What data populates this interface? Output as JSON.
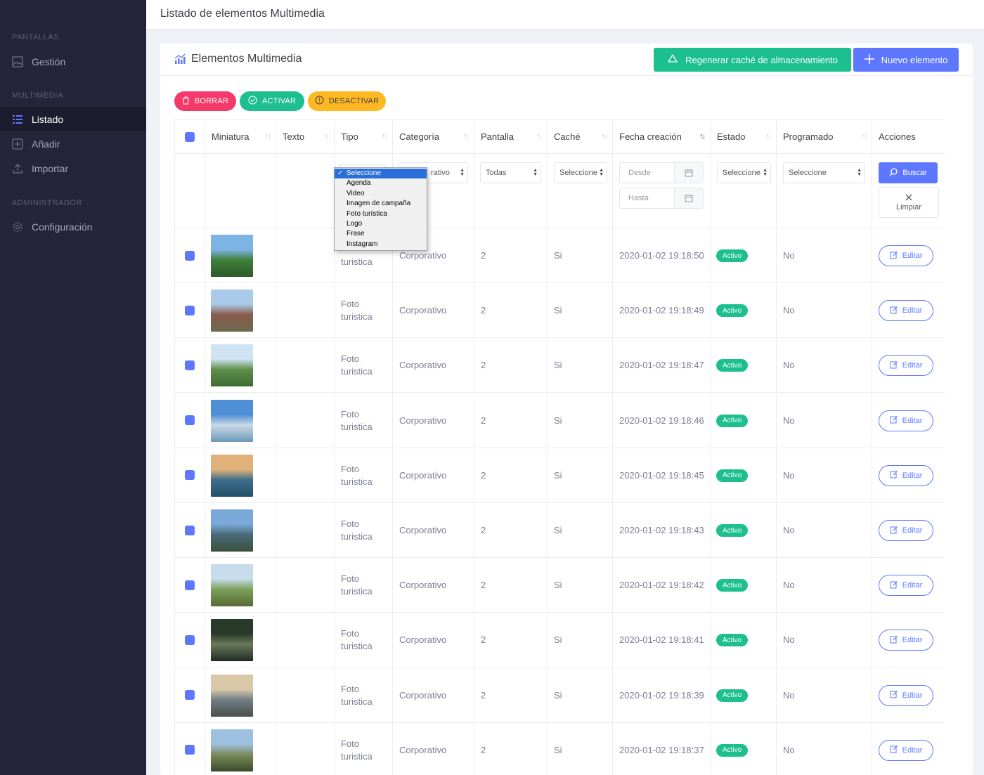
{
  "sidebar": {
    "sections": [
      "PANTALLAS",
      "MULTIMEDIA",
      "ADMINISTRADOR"
    ],
    "items": [
      {
        "label": "Gestión",
        "icon": "image-icon"
      },
      {
        "label": "Listado",
        "icon": "list-icon",
        "active": true
      },
      {
        "label": "Añadir",
        "icon": "plus-square-icon"
      },
      {
        "label": "Importar",
        "icon": "upload-icon"
      },
      {
        "label": "Configuración",
        "icon": "gear-icon"
      }
    ]
  },
  "topbar": {
    "title": "Listado de elementos Multimedia"
  },
  "panel": {
    "title": "Elementos Multimedia",
    "cache_button": "Regenerar caché de almacenamiento",
    "new_button": "Nuevo elemento"
  },
  "bulk_actions": {
    "delete": "BORRAR",
    "activate": "ACTIVAR",
    "deactivate": "DESACTIVAR"
  },
  "table": {
    "headers": [
      "Miniatura",
      "Texto",
      "Tipo",
      "Categoría",
      "Pantalla",
      "Caché",
      "Fecha creación",
      "Estado",
      "Programado",
      "Acciones"
    ],
    "filters": {
      "tipo_options": [
        "Seleccione",
        "Agenda",
        "Video",
        "Imagen de campaña",
        "Foto turística",
        "Logo",
        "Frase",
        "Instagram"
      ],
      "tipo_selected": "Seleccione",
      "categoria_value": "Corporativo",
      "categoria_visible": "rativo",
      "pantalla_value": "Todas",
      "cache_value": "Seleccione",
      "desde_placeholder": "Desde",
      "hasta_placeholder": "Hasta",
      "estado_value": "Seleccione",
      "programado_value": "Seleccione",
      "search_button": "Buscar",
      "clear_button": "Limpiar"
    },
    "rows": [
      {
        "tipo_1": "",
        "tipo_2": "turistica",
        "categoria": "Corporativo",
        "pantalla": "2",
        "cache": "Si",
        "fecha": "2020-01-02 19:18:50",
        "estado": "Activo",
        "programado": "No",
        "accion": "Editar"
      },
      {
        "tipo_1": "Foto",
        "tipo_2": "turistica",
        "categoria": "Corporativo",
        "pantalla": "2",
        "cache": "Si",
        "fecha": "2020-01-02 19:18:49",
        "estado": "Activo",
        "programado": "No",
        "accion": "Editar"
      },
      {
        "tipo_1": "Foto",
        "tipo_2": "turistica",
        "categoria": "Corporativo",
        "pantalla": "2",
        "cache": "Si",
        "fecha": "2020-01-02 19:18:47",
        "estado": "Activo",
        "programado": "No",
        "accion": "Editar"
      },
      {
        "tipo_1": "Foto",
        "tipo_2": "turistica",
        "categoria": "Corporativo",
        "pantalla": "2",
        "cache": "Si",
        "fecha": "2020-01-02 19:18:46",
        "estado": "Activo",
        "programado": "No",
        "accion": "Editar"
      },
      {
        "tipo_1": "Foto",
        "tipo_2": "turistica",
        "categoria": "Corporativo",
        "pantalla": "2",
        "cache": "Si",
        "fecha": "2020-01-02 19:18:45",
        "estado": "Activo",
        "programado": "No",
        "accion": "Editar"
      },
      {
        "tipo_1": "Foto",
        "tipo_2": "turistica",
        "categoria": "Corporativo",
        "pantalla": "2",
        "cache": "Si",
        "fecha": "2020-01-02 19:18:43",
        "estado": "Activo",
        "programado": "No",
        "accion": "Editar"
      },
      {
        "tipo_1": "Foto",
        "tipo_2": "turistica",
        "categoria": "Corporativo",
        "pantalla": "2",
        "cache": "Si",
        "fecha": "2020-01-02 19:18:42",
        "estado": "Activo",
        "programado": "No",
        "accion": "Editar"
      },
      {
        "tipo_1": "Foto",
        "tipo_2": "turistica",
        "categoria": "Corporativo",
        "pantalla": "2",
        "cache": "Si",
        "fecha": "2020-01-02 19:18:41",
        "estado": "Activo",
        "programado": "No",
        "accion": "Editar"
      },
      {
        "tipo_1": "Foto",
        "tipo_2": "turistica",
        "categoria": "Corporativo",
        "pantalla": "2",
        "cache": "Si",
        "fecha": "2020-01-02 19:18:39",
        "estado": "Activo",
        "programado": "No",
        "accion": "Editar"
      },
      {
        "tipo_1": "Foto",
        "tipo_2": "turistica",
        "categoria": "Corporativo",
        "pantalla": "2",
        "cache": "Si",
        "fecha": "2020-01-02 19:18:37",
        "estado": "Activo",
        "programado": "No",
        "accion": "Editar"
      }
    ]
  },
  "colors": {
    "sidebar": "#24243a",
    "primary": "#5d78ff",
    "success": "#1dbf8f",
    "danger": "#f43a6b",
    "warning": "#ffb822"
  }
}
